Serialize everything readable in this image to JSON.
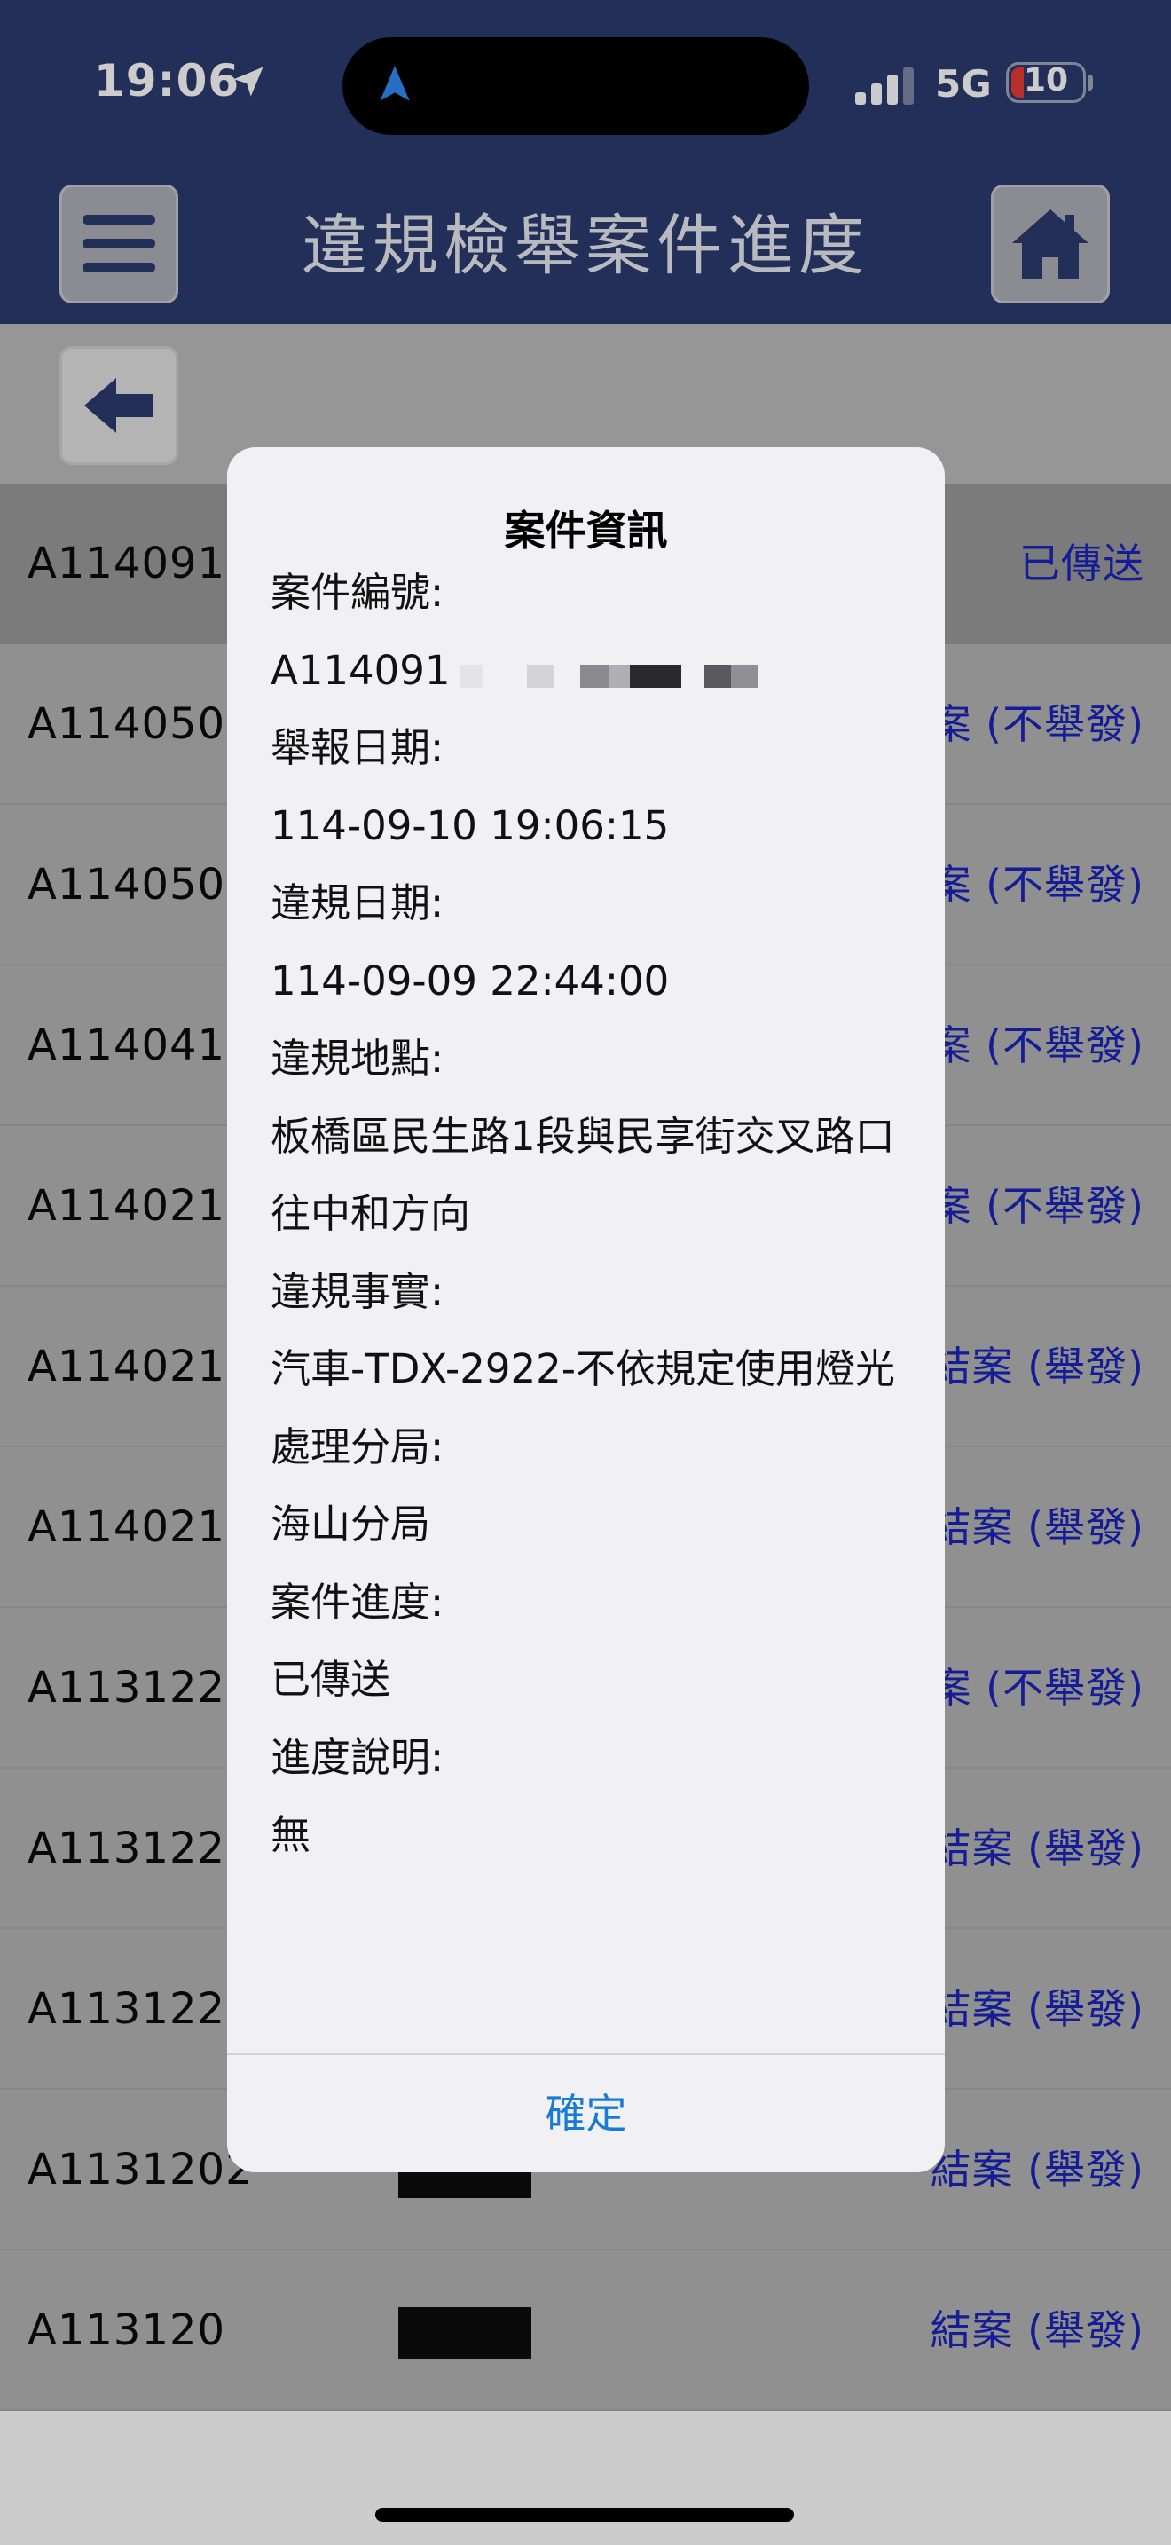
{
  "status_bar": {
    "time": "19:06",
    "network": "5G",
    "battery": "10"
  },
  "header": {
    "title": "違規檢舉案件進度"
  },
  "colors": {
    "header_bg": "#2b3b6e",
    "link_blue": "#1a25b8",
    "dialog_button": "#1a7ad6",
    "battery_low": "#e53b36"
  },
  "icons": {
    "menu": "hamburger-menu-icon",
    "home": "home-icon",
    "back": "back-arrow-icon"
  },
  "case_list": [
    {
      "id": "A1140910",
      "status": "已傳送"
    },
    {
      "id": "A1140503",
      "status": "案 (不舉發)"
    },
    {
      "id": "A1140502",
      "status": "案 (不舉發)"
    },
    {
      "id": "A1140412",
      "status": "案 (不舉發)"
    },
    {
      "id": "A1140219",
      "status": "案 (不舉發)"
    },
    {
      "id": "A1140219",
      "status": "結案 (舉發)"
    },
    {
      "id": "A1140219",
      "status": "結案 (舉發)"
    },
    {
      "id": "A1131228",
      "status": "案 (不舉發)"
    },
    {
      "id": "A1131228",
      "status": "結案 (舉發)"
    },
    {
      "id": "A1131228",
      "status": "結案 (舉發)"
    },
    {
      "id": "A1131202",
      "status": "結案 (舉發)"
    },
    {
      "id": "A113120",
      "status": "結案 (舉發)"
    }
  ],
  "dialog": {
    "title": "案件資訊",
    "case_number_label": "案件編號:",
    "case_number_value": "A114091",
    "report_date_label": "舉報日期:",
    "report_date_value": "114-09-10 19:06:15",
    "violation_date_label": "違規日期:",
    "violation_date_value": "114-09-09 22:44:00",
    "location_label": "違規地點:",
    "location_value": "板橋區民生路1段與民享街交叉路口往中和方向",
    "fact_label": "違規事實:",
    "fact_value": "汽車-TDX-2922-不依規定使用燈光",
    "branch_label": "處理分局:",
    "branch_value": "海山分局",
    "progress_label": "案件進度:",
    "progress_value": "已傳送",
    "note_label": "進度說明:",
    "note_value": "無",
    "ok_label": "確定"
  }
}
